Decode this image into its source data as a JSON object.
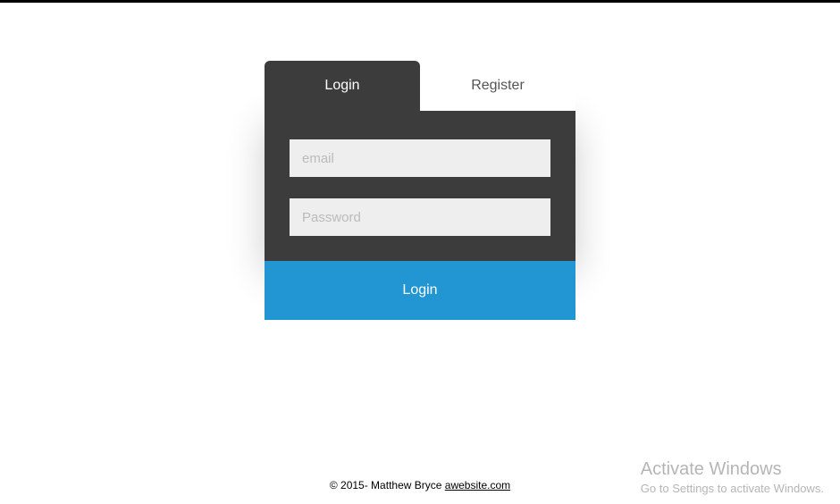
{
  "tabs": {
    "login": "Login",
    "register": "Register"
  },
  "form": {
    "email_placeholder": "email",
    "password_placeholder": "Password",
    "submit_label": "Login"
  },
  "footer": {
    "copyright_prefix": "© 2015- Matthew Bryce ",
    "link_text": "awebsite.com"
  },
  "watermark": {
    "title": "Activate Windows",
    "subtitle": "Go to Settings to activate Windows."
  }
}
